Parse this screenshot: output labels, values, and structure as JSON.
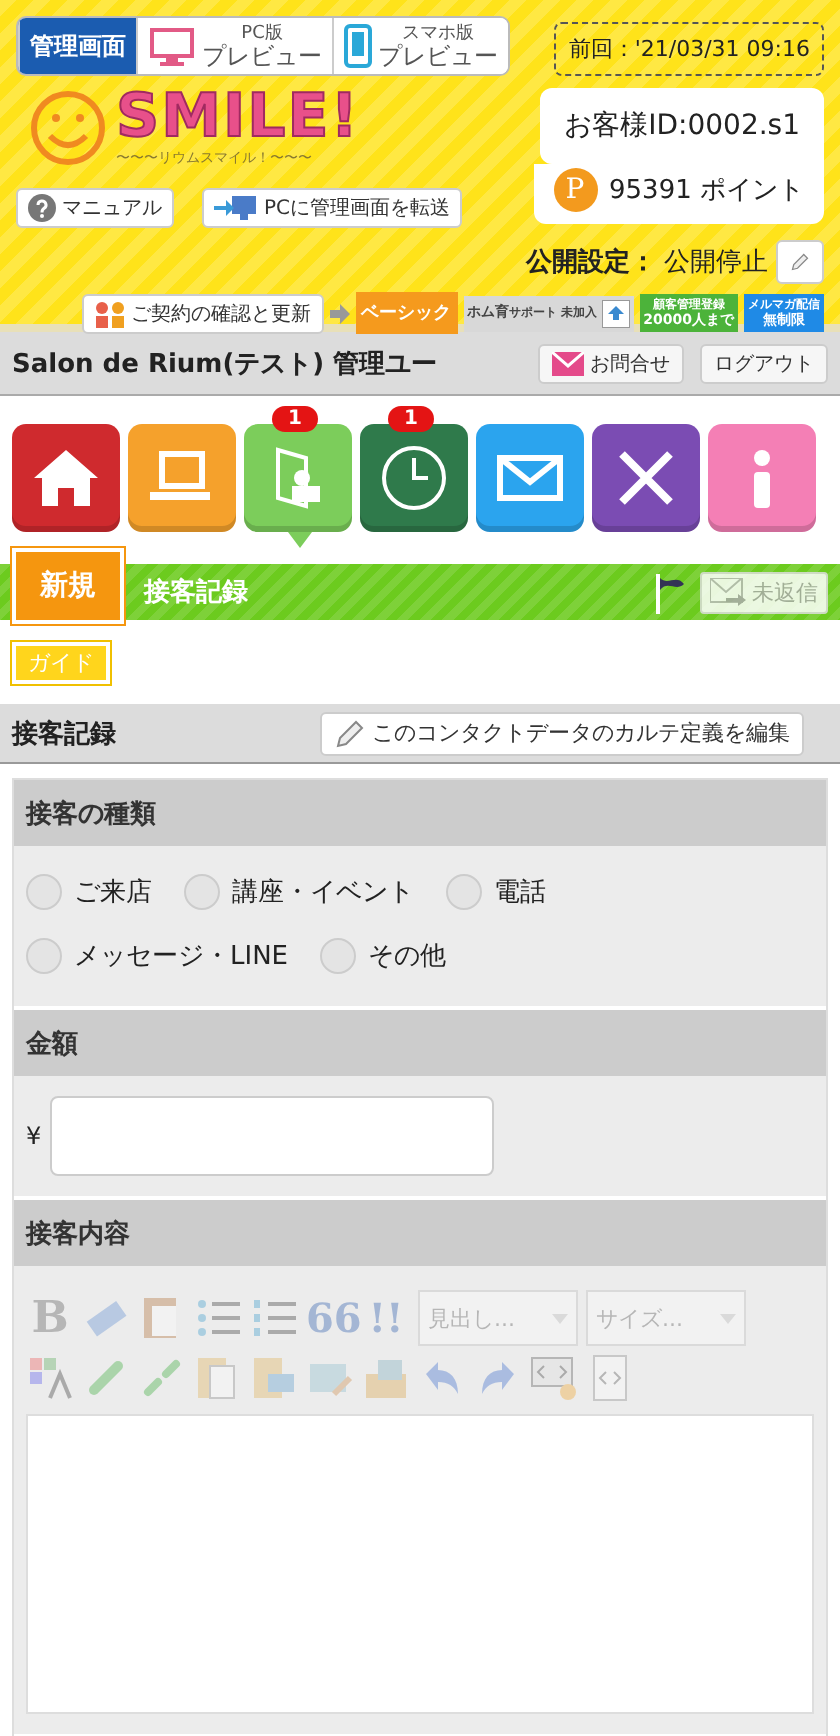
{
  "header": {
    "tabs": [
      {
        "kind": "admin",
        "label": "管理画面",
        "selected": true
      },
      {
        "kind": "pc",
        "small": "PC版",
        "label": "プレビュー",
        "selected": false
      },
      {
        "kind": "phone",
        "small": "スマホ版",
        "label": "プレビュー",
        "selected": false
      }
    ],
    "last_login": "前回：'21/03/31 09:16",
    "logo": {
      "title": "SMILE!",
      "subtitle": "〜〜〜リウムスマイル！〜〜〜"
    },
    "customer_id": "お客様ID:0002.s1",
    "points": {
      "badge": "P",
      "value": "95391 ポイント"
    },
    "links": [
      {
        "kind": "help",
        "label": "マニュアル"
      },
      {
        "kind": "transfer",
        "label": "PCに管理画面を転送"
      }
    ],
    "publish": {
      "label": "公開設定：",
      "value": "公開停止"
    },
    "contract": {
      "label": "ご契約の確認と更新",
      "plan": "ベーシック",
      "badges": [
        {
          "kind": "support",
          "top": "ホム育",
          "bottom": "サポート 未加入"
        },
        {
          "kind": "green",
          "top": "顧客管理登録",
          "bottom": "20000人まで"
        },
        {
          "kind": "blue",
          "top": "メルマガ配信",
          "bottom": "無制限"
        }
      ]
    }
  },
  "title_bar": {
    "title": "Salon de Rium(テスト) 管理ユー",
    "buttons": [
      {
        "kind": "contact",
        "label": "お問合せ"
      },
      {
        "kind": "plain",
        "label": "ログアウト"
      }
    ]
  },
  "nav": {
    "items": [
      {
        "kind": "home",
        "color": "#cf2a2e",
        "selected": false
      },
      {
        "kind": "laptop",
        "color": "#f5a12c",
        "selected": false
      },
      {
        "kind": "folder",
        "color": "#7ccd5b",
        "selected": true,
        "badge": "1"
      },
      {
        "kind": "clock",
        "color": "#2f7a4b",
        "selected": false,
        "badge": "1"
      },
      {
        "kind": "mail",
        "color": "#2ba4ee",
        "selected": false
      },
      {
        "kind": "tools",
        "color": "#7b4cb3",
        "selected": false
      },
      {
        "kind": "info",
        "color": "#f47fb5",
        "selected": false
      }
    ]
  },
  "sub_bar": {
    "new_button": "新規",
    "title": "接客記録",
    "unreplied": {
      "label": "未返信",
      "disabled": true
    },
    "guide": "ガイド"
  },
  "section": {
    "title": "接客記録",
    "edit_button": "このコンタクトデータのカルテ定義を編集"
  },
  "form": [
    {
      "kind": "radio",
      "title": "接客の種類",
      "options": [
        {
          "label": "ご来店",
          "selected": false
        },
        {
          "label": "講座・イベント",
          "selected": false
        },
        {
          "label": "電話",
          "selected": false
        },
        {
          "label": "メッセージ・LINE",
          "selected": false
        },
        {
          "label": "その他",
          "selected": false
        }
      ]
    },
    {
      "kind": "money",
      "title": "金額",
      "prefix": "¥"
    },
    {
      "kind": "editor",
      "title": "接客内容",
      "tools": [
        {
          "kind": "text",
          "label": "B"
        },
        {
          "kind": "eraser"
        },
        {
          "kind": "paste"
        },
        {
          "kind": "bullets"
        },
        {
          "kind": "numbers"
        },
        {
          "kind": "text",
          "label": "66"
        },
        {
          "kind": "text",
          "label": "!!"
        },
        {
          "kind": "select",
          "value": "見出し..."
        },
        {
          "kind": "select",
          "value": "サイズ..."
        },
        {
          "kind": "color"
        },
        {
          "kind": "link"
        },
        {
          "kind": "unlink"
        },
        {
          "kind": "file"
        },
        {
          "kind": "folder"
        },
        {
          "kind": "image"
        },
        {
          "kind": "picture"
        },
        {
          "kind": "undo"
        },
        {
          "kind": "redo"
        },
        {
          "kind": "code"
        },
        {
          "kind": "source"
        }
      ]
    }
  ]
}
